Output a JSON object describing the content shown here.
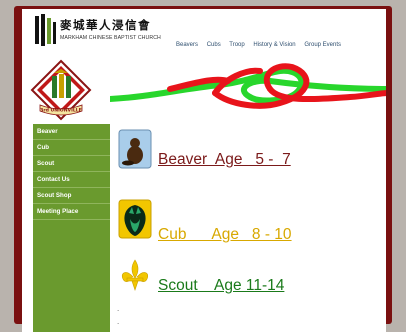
{
  "header": {
    "chinese_name": "麥城華人浸信會",
    "english_name": "MARKHAM CHINESE BAPTIST CHURCH",
    "nav": [
      "Beavers",
      "Cubs",
      "Troop",
      "History & Vision",
      "Group Events"
    ]
  },
  "crest": {
    "banner": "3rd UNIONVILLE"
  },
  "sidebar": {
    "items": [
      {
        "label": "Beaver"
      },
      {
        "label": "Cub"
      },
      {
        "label": "Scout"
      },
      {
        "label": "Contact Us"
      },
      {
        "label": "Scout Shop"
      },
      {
        "label": "Meeting Place"
      }
    ]
  },
  "sections": [
    {
      "name": "Beaver",
      "label": "Beaver  Age   5 -  7",
      "color": "#7b1a1a",
      "icon": "beaver-icon"
    },
    {
      "name": "Cub",
      "label": "Cub      Age   8 - 10",
      "color": "#d8a800",
      "icon": "wolf-icon"
    },
    {
      "name": "Scout",
      "label": "Scout    Age 11-14",
      "color": "#1a7a1a",
      "icon": "fleur-de-lis-icon"
    }
  ],
  "colors": {
    "frame": "#7a1010",
    "sidebar": "#6a9a2e",
    "knot_red": "#e8141b",
    "knot_green": "#28d62c"
  }
}
